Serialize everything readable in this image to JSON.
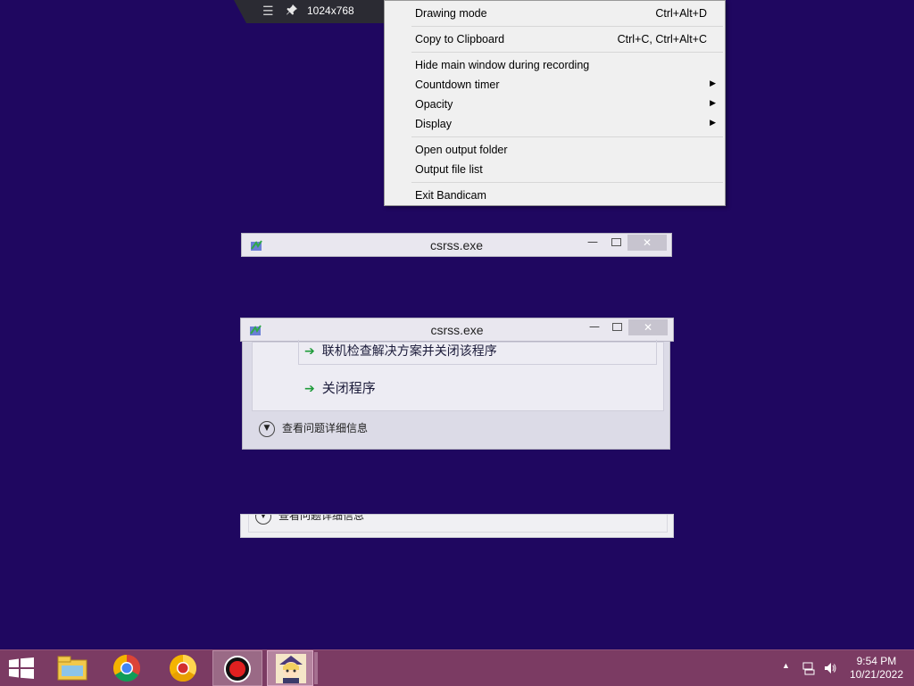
{
  "bandicam_bar": {
    "menu_icon": "hamburger-icon",
    "pin_icon": "pin-icon",
    "resolution": "1024x768"
  },
  "context_menu": {
    "items": [
      {
        "label": "Drawing mode",
        "shortcut": "Ctrl+Alt+D"
      },
      {
        "label": "Copy to Clipboard",
        "shortcut": "Ctrl+C, Ctrl+Alt+C"
      },
      {
        "label": "Hide main window during recording"
      },
      {
        "label": "Countdown timer",
        "submenu": true
      },
      {
        "label": "Opacity",
        "submenu": true
      },
      {
        "label": "Display",
        "submenu": true
      },
      {
        "label": "Open output folder"
      },
      {
        "label": "Output file list"
      },
      {
        "label": "Exit Bandicam"
      }
    ]
  },
  "dialog1": {
    "title": "csrss.exe"
  },
  "dialog2": {
    "title": "csrss.exe",
    "option_online": "联机检查解决方案并关闭该程序",
    "option_close": "关闭程序",
    "details": "查看问题详细信息"
  },
  "fragment": {
    "details": "查看问题详细信息"
  },
  "taskbar": {
    "items": [
      "windows-start-icon",
      "file-explorer-icon",
      "chrome-icon",
      "chrome-canary-icon",
      "bandicam-record-icon",
      "anime-app-icon"
    ],
    "time": "9:54 PM",
    "date": "10/21/2022"
  },
  "colors": {
    "desktop": "#1f0760",
    "taskbar": "#7b3b63"
  }
}
